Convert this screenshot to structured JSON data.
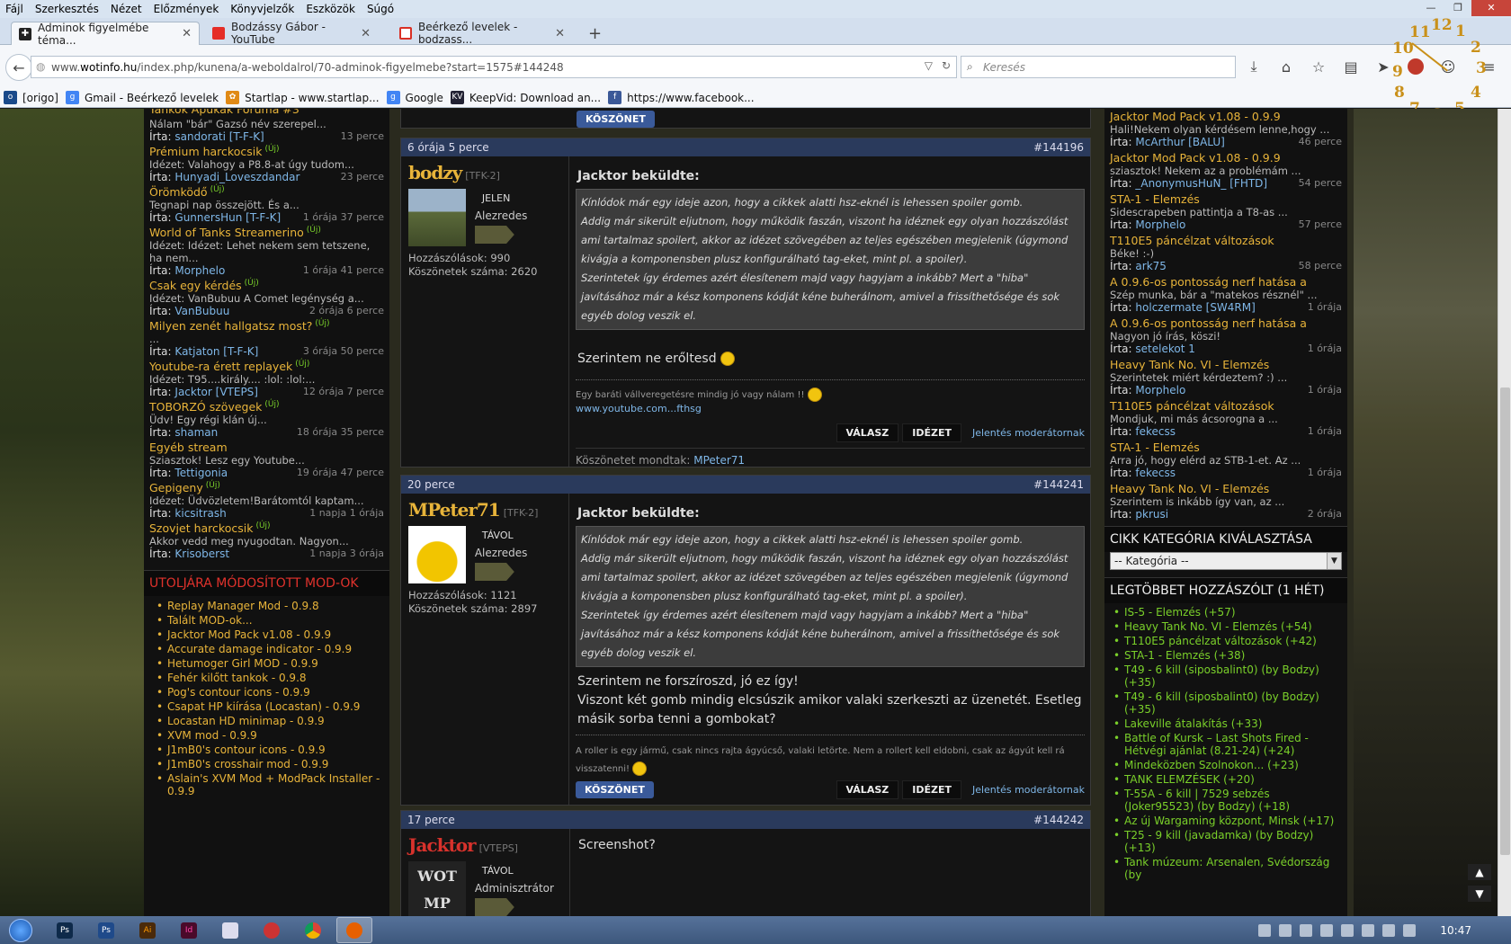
{
  "menubar": [
    "Fájl",
    "Szerkesztés",
    "Nézet",
    "Előzmények",
    "Könyvjelzők",
    "Eszközök",
    "Súgó"
  ],
  "tabs": [
    {
      "label": "Adminok figyelmébe téma...",
      "active": true
    },
    {
      "label": "Bodzássy Gábor - YouTube",
      "active": false
    },
    {
      "label": "Beérkező levelek - bodzass...",
      "active": false
    }
  ],
  "address": {
    "prefix": "www.",
    "host": "wotinfo.hu",
    "path": "/index.php/kunena/a-weboldalrol/70-adminok-figyelmebe?start=1575#144248"
  },
  "search": {
    "placeholder": "Keresés"
  },
  "bookmarks": [
    "[origo]",
    "Gmail - Beérkező levelek",
    "Startlap - www.startlap...",
    "Google",
    "KeepVid: Download an...",
    "https://www.facebook..."
  ],
  "clock": [
    "1",
    "2",
    "3",
    "4",
    "5",
    "6",
    "7",
    "8",
    "9",
    "10",
    "11",
    "12"
  ],
  "left_topics": [
    {
      "title": "",
      "quote": "Nálam \"bár\" Gazsó név szerepel...",
      "author": "sandorati [T-F-K]",
      "time": "13 perce",
      "new": ""
    },
    {
      "title": "Prémium harckocsik",
      "quote": "Idézet: Valahogy a P8.8-at úgy tudom...",
      "author": "Hunyadi_Loveszdandar",
      "time": "23 perce",
      "new": "(Új)"
    },
    {
      "title": "Örömködő",
      "quote": "Tegnapi nap összejött. És a...",
      "author": "GunnersHun [T-F-K]",
      "time": "1 órája 37 perce",
      "new": "(Új)"
    },
    {
      "title": "World of Tanks Streamerino",
      "quote": "Idézet: Idézet: Lehet nekem sem tetszene, ha nem...",
      "author": "Morphelo",
      "time": "1 órája 41 perce",
      "new": "(Új)"
    },
    {
      "title": "Csak egy kérdés",
      "quote": "Idézet: VanBubuu A Comet legénység a...",
      "author": "VanBubuu",
      "time": "2 órája 6 perce",
      "new": "(Új)"
    },
    {
      "title": "Milyen zenét hallgatsz most?",
      "quote": "...",
      "author": "Katjaton [T-F-K]",
      "time": "3 órája 50 perce",
      "new": "(Új)"
    },
    {
      "title": "Youtube-ra érett replayek",
      "quote": "Idézet: T95....király.... :lol: :lol:...",
      "author": "Jacktor [VTEPS]",
      "time": "12 órája 7 perce",
      "new": "(Új)"
    },
    {
      "title": "TOBORZÓ szövegek",
      "quote": "Üdv! Egy régi klán új...",
      "author": "shaman",
      "time": "18 órája 35 perce",
      "new": "(Új)"
    },
    {
      "title": "Egyéb stream",
      "quote": "Sziasztok! Lesz egy Youtube...",
      "author": "Tettigonia",
      "time": "19 órája 47 perce",
      "new": ""
    },
    {
      "title": "Gepigeny",
      "quote": "Idézet: Üdvözletem!Barátomtól kaptam...",
      "author": "kicsitrash",
      "time": "1 napja 1 órája",
      "new": "(Új)"
    },
    {
      "title": "Szovjet harckocsik",
      "quote": "Akkor vedd meg nyugodtan. Nagyon...",
      "author": "Krisoberst",
      "time": "1 napja 3 órája",
      "new": "(Új)"
    }
  ],
  "left_partial_title": "Tankok Apukák Fóruma #3",
  "ira": "Írta:",
  "mods": {
    "header": "UTOLJÁRA MÓDOSÍTOTT MOD-OK",
    "items": [
      "Replay Manager Mod - 0.9.8",
      "Talált MOD-ok...",
      "Jacktor Mod Pack v1.08 - 0.9.9",
      "Accurate damage indicator - 0.9.9",
      "Hetumoger Girl MOD - 0.9.9",
      "Fehér kilőtt tankok - 0.9.8",
      "Pog's contour icons - 0.9.9",
      "Csapat HP kiírása (Locastan) - 0.9.9",
      "Locastan HD minimap - 0.9.9",
      "XVM mod - 0.9.9",
      "J1mB0's contour icons - 0.9.9",
      "J1mB0's crosshair mod - 0.9.9",
      "Aslain's XVM Mod + ModPack Installer - 0.9.9"
    ]
  },
  "top_thanks_btn": "KÖSZÖNET",
  "posts": [
    {
      "time": "6 órája 5 perce",
      "id": "#144196",
      "user": "bodzy",
      "tag": "[TFK-2]",
      "status": "JELEN",
      "rank": "Alezredes",
      "posts_label": "Hozzászólások: 990",
      "thanks_label": "Köszönetek száma: 2620",
      "quote_head": "Jacktor beküldte:",
      "quote": "Kínlódok már egy ideje azon, hogy a cikkek alatti hsz-eknél is lehessen spoiler gomb.\nAddig már sikerült eljutnom, hogy működik faszán, viszont ha idéznek egy olyan hozzászólást ami tartalmaz spoilert, akkor az idézet szövegében az teljes egészében megjelenik (úgymond kivágja a komponensben plusz konfigurálható tag-eket, mint pl. a spoiler).\nSzerintetek így érdemes azért élesítenem majd vagy hagyjam a inkább? Mert a \"hiba\" javításához már a kész komponens kódját kéne buherálnom, amivel a frissíthetősége és sok egyéb dolog veszik el.",
      "text": "Szerintem ne erőltesd",
      "sig": "Egy baráti vállveregetésre mindig jó vagy nálam !!",
      "sig_link": "www.youtube.com...fthsg",
      "reply": "VÁLASZ",
      "quote_btn": "IDÉZET",
      "report": "Jelentés moderátornak",
      "thanks_prefix": "Köszönetet mondtak:",
      "thanks_by": "MPeter71"
    },
    {
      "time": "20 perce",
      "id": "#144241",
      "user": "MPeter71",
      "tag": "[TFK-2]",
      "status": "TÁVOL",
      "rank": "Alezredes",
      "posts_label": "Hozzászólások: 1121",
      "thanks_label": "Köszönetek száma: 2897",
      "quote_head": "Jacktor beküldte:",
      "quote": "Kínlódok már egy ideje azon, hogy a cikkek alatti hsz-eknél is lehessen spoiler gomb.\nAddig már sikerült eljutnom, hogy működik faszán, viszont ha idéznek egy olyan hozzászólást ami tartalmaz spoilert, akkor az idézet szövegében az teljes egészében megjelenik (úgymond kivágja a komponensben plusz konfigurálható tag-eket, mint pl. a spoiler).\nSzerintetek így érdemes azért élesítenem majd vagy hagyjam a inkább? Mert a \"hiba\" javításához már a kész komponens kódját kéne buherálnom, amivel a frissíthetősége és sok egyéb dolog veszik el.",
      "text1": "Szerintem ne forszíroszd, jó ez így!",
      "text2": "Viszont két gomb mindig elcsúszik amikor valaki szerkeszti az üzenetét. Esetleg másik sorba tenni a gombokat?",
      "sig": "A roller is egy jármű, csak nincs rajta ágyúcső, valaki letörte. Nem a rollert kell eldobni, csak az ágyút kell rá visszatenni!",
      "thanks_btn": "KÖSZÖNET",
      "reply": "VÁLASZ",
      "quote_btn": "IDÉZET",
      "report": "Jelentés moderátornak"
    },
    {
      "time": "17 perce",
      "id": "#144242",
      "user": "Jacktor",
      "tag": "[VTEPS]",
      "status": "TÁVOL",
      "rank": "Adminisztrátor",
      "text": "Screenshot?",
      "avatar_text": "WOT MP"
    }
  ],
  "right_topics": [
    {
      "title": "Jacktor Mod Pack v1.08 - 0.9.9",
      "quote": "Hali!Nekem olyan kérdésem lenne,hogy ...",
      "author": "McArthur [BALU]",
      "time": "46 perce"
    },
    {
      "title": "Jacktor Mod Pack v1.08 - 0.9.9",
      "quote": "sziasztok! Nekem az a problémám ...",
      "author": "_AnonymusHuN_ [FHTD]",
      "time": "54 perce"
    },
    {
      "title": "STA-1 - Elemzés",
      "quote": "Sidescrapeben pattintja a T8-as ...",
      "author": "Morphelo",
      "time": "57 perce"
    },
    {
      "title": "T110E5 páncélzat változások",
      "quote": "Béke! :-)",
      "author": "ark75",
      "time": "58 perce"
    },
    {
      "title": "A 0.9.6-os pontosság nerf hatása a",
      "quote": "Szép munka, bár a \"matekos résznél\" ...",
      "author": "holczermate [SW4RM]",
      "time": "1 órája"
    },
    {
      "title": "A 0.9.6-os pontosság nerf hatása a",
      "quote": "Nagyon jó írás, köszi!",
      "author": "setelekot 1",
      "time": "1 órája"
    },
    {
      "title": "Heavy Tank No. VI - Elemzés",
      "quote": "Szerintetek miért kérdeztem? :) ...",
      "author": "Morphelo",
      "time": "1 órája"
    },
    {
      "title": "T110E5 páncélzat változások",
      "quote": "Mondjuk, mi más ácsorogna a ...",
      "author": "fekecss",
      "time": "1 órája"
    },
    {
      "title": "STA-1 - Elemzés",
      "quote": "Arra jó, hogy elérd az STB-1-et. Az ...",
      "author": "fekecss",
      "time": "1 órája"
    },
    {
      "title": "Heavy Tank No. VI - Elemzés",
      "quote": "Szerintem is inkább így van, az ...",
      "author": "pkrusi",
      "time": "2 órája"
    }
  ],
  "category": {
    "header": "CIKK KATEGÓRIA KIVÁLASZTÁSA",
    "selected": "-- Kategória --"
  },
  "most_commented": {
    "header": "LEGTÖBBET HOZZÁSZÓLT (1 HÉT)",
    "items": [
      "IS-5 - Elemzés (+57)",
      "Heavy Tank No. VI - Elemzés (+54)",
      "T110E5 páncélzat változások (+42)",
      "STA-1 - Elemzés (+38)",
      "T49 - 6 kill (siposbalint0) (by Bodzy) (+35)",
      "T49 - 6 kill (siposbalint0) (by Bodzy) (+35)",
      "Lakeville átalakítás (+33)",
      "Battle of Kursk – Last Shots Fired - Hétvégi ajánlat (8.21-24) (+24)",
      "Mindeközben Szolnokon... (+23)",
      "TANK ELEMZÉSEK (+20)",
      "T-55A - 6 kill | 7529 sebzés (Joker95523) (by Bodzy) (+18)",
      "Az új Wargaming központ, Minsk (+17)",
      "T25 - 9 kill (javadamka) (by Bodzy) (+13)",
      "Tank múzeum: Arsenalen, Svédország (by"
    ]
  },
  "taskbar": {
    "time": "10:47",
    "apps": [
      "Ps",
      "Ps",
      "Ai",
      "Id",
      "",
      "",
      "",
      "Fx"
    ]
  }
}
